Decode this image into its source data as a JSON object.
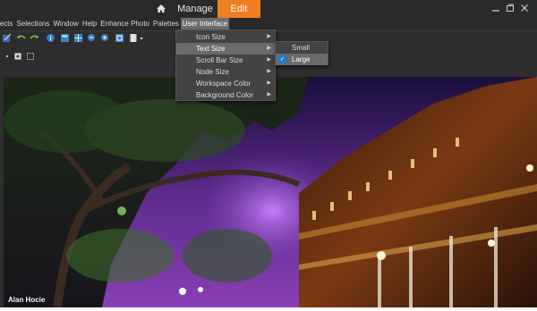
{
  "modebar": {
    "manage_label": "Manage",
    "edit_label": "Edit",
    "accent_color": "#f07e22"
  },
  "menubar": {
    "items": [
      "jects",
      "Selections",
      "Window",
      "Help",
      "Enhance Photo",
      "Palettes",
      "User Interface"
    ],
    "active": "User Interface"
  },
  "dropdown": {
    "items": [
      {
        "label": "Icon Size"
      },
      {
        "label": "Text Size"
      },
      {
        "label": "Scroll Bar Size"
      },
      {
        "label": "Node Size"
      },
      {
        "label": "Workspace Color"
      },
      {
        "label": "Background Color"
      }
    ],
    "highlighted": "Text Size"
  },
  "submenu": {
    "items": [
      {
        "label": "Small"
      },
      {
        "label": "Large"
      }
    ],
    "selected": "Large",
    "check_color": "#1f7bd2"
  },
  "photo": {
    "credit": "Alan Hocie"
  },
  "icons": [
    "home-icon",
    "minimize-icon",
    "restore-icon",
    "close-icon",
    "undo-icon",
    "redo-icon",
    "info-icon",
    "zoom-in-icon",
    "zoom-out-icon",
    "fit-icon"
  ]
}
